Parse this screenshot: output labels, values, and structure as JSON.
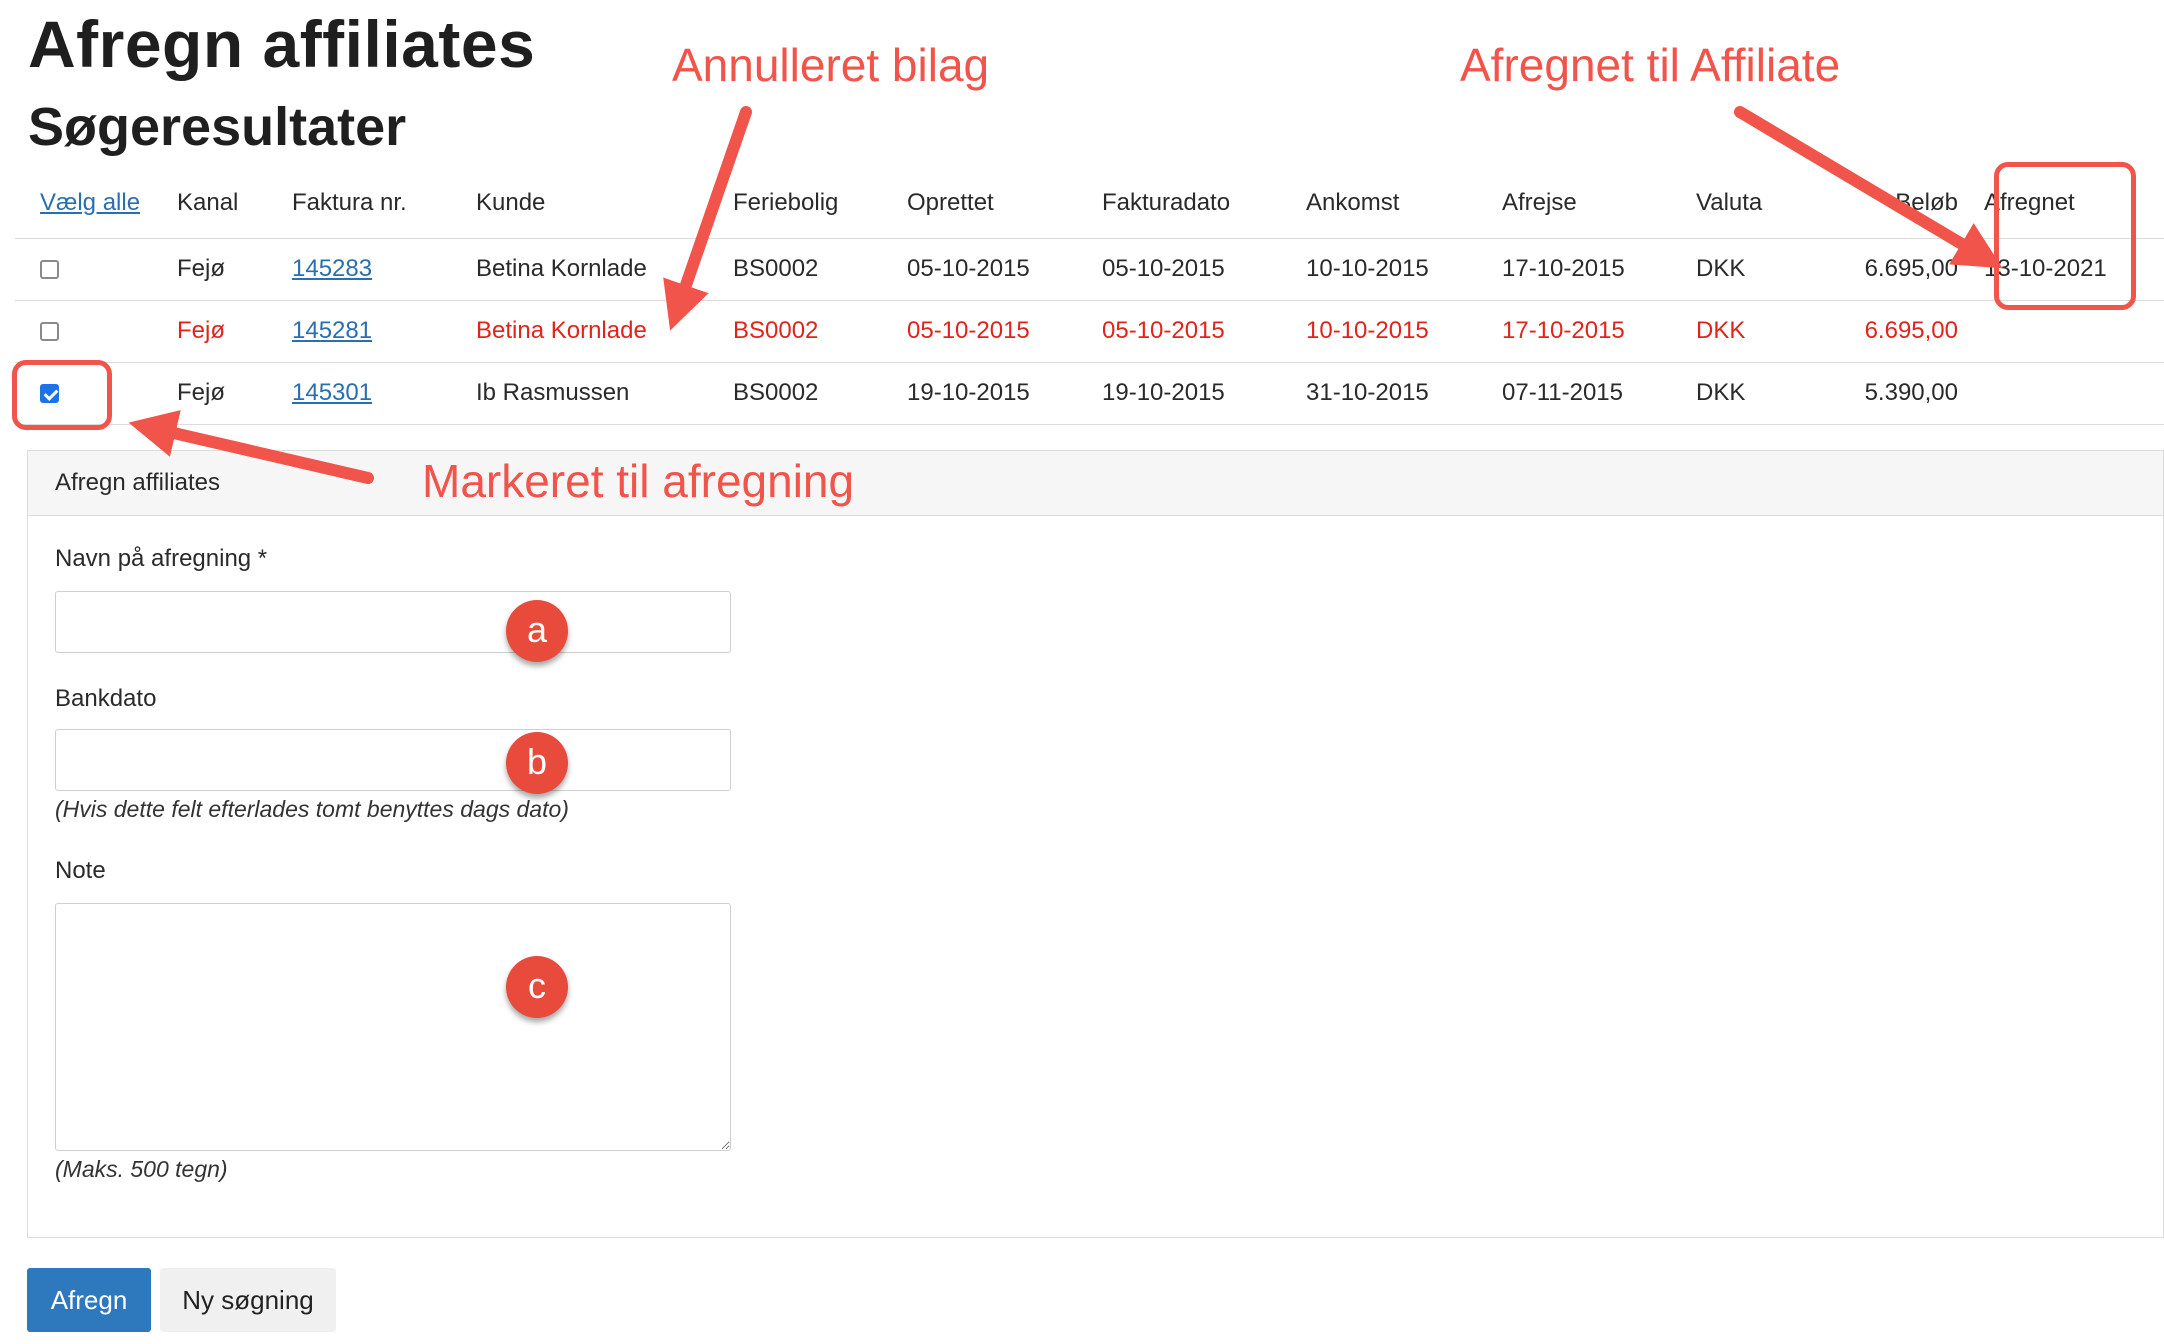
{
  "page": {
    "title": "Afregn affiliates",
    "subtitle": "Søgeresultater"
  },
  "table": {
    "select_all": "Vælg alle",
    "columns": [
      "Kanal",
      "Faktura nr.",
      "Kunde",
      "Feriebolig",
      "Oprettet",
      "Fakturadato",
      "Ankomst",
      "Afrejse",
      "Valuta",
      "Beløb",
      "Afregnet"
    ],
    "rows": [
      {
        "checked": false,
        "cancelled": false,
        "kanal": "Fejø",
        "faktura": "145283",
        "kunde": "Betina Kornlade",
        "feriebolig": "BS0002",
        "oprettet": "05-10-2015",
        "fakturadato": "05-10-2015",
        "ankomst": "10-10-2015",
        "afrejse": "17-10-2015",
        "valuta": "DKK",
        "belob": "6.695,00",
        "afregnet": "13-10-2021"
      },
      {
        "checked": false,
        "cancelled": true,
        "kanal": "Fejø",
        "faktura": "145281",
        "kunde": "Betina Kornlade",
        "feriebolig": "BS0002",
        "oprettet": "05-10-2015",
        "fakturadato": "05-10-2015",
        "ankomst": "10-10-2015",
        "afrejse": "17-10-2015",
        "valuta": "DKK",
        "belob": "6.695,00",
        "afregnet": ""
      },
      {
        "checked": true,
        "cancelled": false,
        "kanal": "Fejø",
        "faktura": "145301",
        "kunde": "Ib Rasmussen",
        "feriebolig": "BS0002",
        "oprettet": "19-10-2015",
        "fakturadato": "19-10-2015",
        "ankomst": "31-10-2015",
        "afrejse": "07-11-2015",
        "valuta": "DKK",
        "belob": "5.390,00",
        "afregnet": ""
      }
    ]
  },
  "form": {
    "panel_title": "Afregn affiliates",
    "name_label": "Navn på afregning *",
    "name_value": "",
    "bankdato_label": "Bankdato",
    "bankdato_value": "",
    "bankdato_help": "(Hvis dette felt efterlades tomt benyttes dags dato)",
    "note_label": "Note",
    "note_help": "(Maks. 500 tegn)"
  },
  "buttons": {
    "submit": "Afregn",
    "new_search": "Ny søgning"
  },
  "annotations": {
    "cancelled": "Annulleret bilag",
    "settled": "Afregnet til Affiliate",
    "marked": "Markeret til afregning",
    "badge_a": "a",
    "badge_b": "b",
    "badge_c": "c",
    "color": "#f0544a"
  },
  "colors": {
    "link": "#2a6fb0",
    "cancelled_text": "#e0241c",
    "primary_button": "#2e78be",
    "checkbox_checked": "#1a73e8"
  }
}
